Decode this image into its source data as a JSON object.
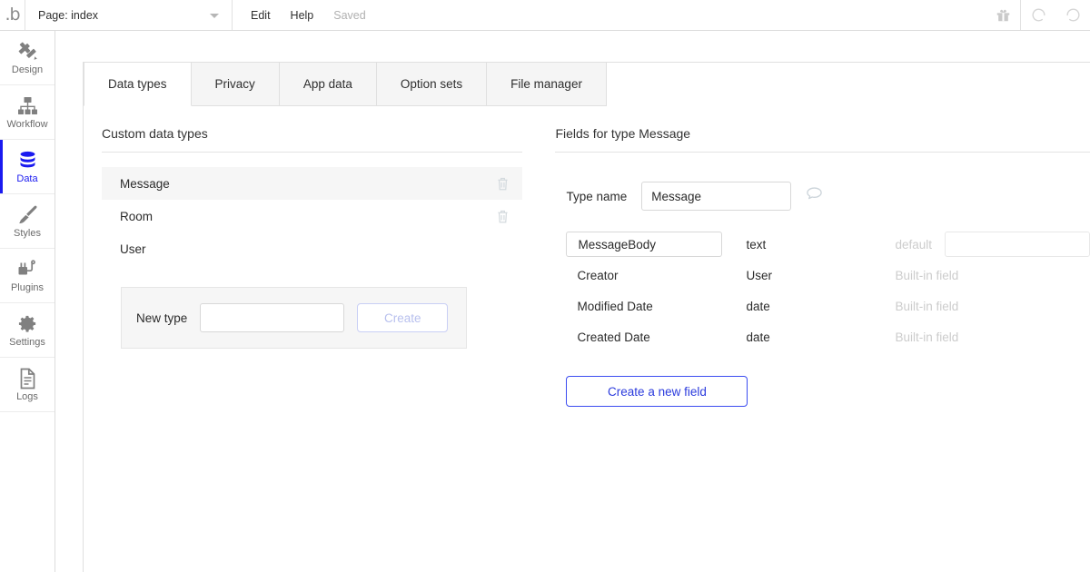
{
  "topbar": {
    "logo": "bubble-logo",
    "page_label": "Page: index",
    "menu": [
      {
        "label": "Edit",
        "muted": false
      },
      {
        "label": "Help",
        "muted": false
      },
      {
        "label": "Saved",
        "muted": true
      }
    ],
    "right_icons": [
      "gift-icon",
      "undo-icon",
      "redo-icon"
    ]
  },
  "sidebar": {
    "items": [
      {
        "label": "Design",
        "icon": "design-icon",
        "active": false
      },
      {
        "label": "Workflow",
        "icon": "workflow-icon",
        "active": false
      },
      {
        "label": "Data",
        "icon": "database-icon",
        "active": true
      },
      {
        "label": "Styles",
        "icon": "brush-icon",
        "active": false
      },
      {
        "label": "Plugins",
        "icon": "plugins-icon",
        "active": false
      },
      {
        "label": "Settings",
        "icon": "gear-icon",
        "active": false
      },
      {
        "label": "Logs",
        "icon": "document-icon",
        "active": false
      }
    ]
  },
  "tabs": [
    {
      "label": "Data types",
      "active": true
    },
    {
      "label": "Privacy",
      "active": false
    },
    {
      "label": "App data",
      "active": false
    },
    {
      "label": "Option sets",
      "active": false
    },
    {
      "label": "File manager",
      "active": false
    }
  ],
  "left_panel": {
    "title": "Custom data types",
    "types": [
      {
        "name": "Message",
        "selected": true,
        "deletable": true
      },
      {
        "name": "Room",
        "selected": false,
        "deletable": true
      },
      {
        "name": "User",
        "selected": false,
        "deletable": false
      }
    ],
    "new_type": {
      "label": "New type",
      "input_value": "",
      "input_placeholder": "",
      "create_label": "Create",
      "create_disabled": true
    }
  },
  "right_panel": {
    "title": "Fields for type Message",
    "type_name": {
      "label": "Type name",
      "value": "Message",
      "comment_icon": "speech-bubble-icon"
    },
    "fields": [
      {
        "name": "MessageBody",
        "type": "text",
        "boxed": true,
        "meta": "default",
        "has_default_input": true,
        "default_value": ""
      },
      {
        "name": "Creator",
        "type": "User",
        "boxed": false,
        "meta": "Built-in field",
        "has_default_input": false,
        "default_value": ""
      },
      {
        "name": "Modified Date",
        "type": "date",
        "boxed": false,
        "meta": "Built-in field",
        "has_default_input": false,
        "default_value": ""
      },
      {
        "name": "Created Date",
        "type": "date",
        "boxed": false,
        "meta": "Built-in field",
        "has_default_input": false,
        "default_value": ""
      }
    ],
    "create_field_label": "Create a new field"
  },
  "colors": {
    "accent_blue": "#1a1af0",
    "button_blue": "#2b3bdd",
    "selected_row": "#f6f6f6",
    "tab_inactive": "#f5f5f5",
    "border": "#e0e0e0",
    "muted_text": "#cccccc"
  }
}
